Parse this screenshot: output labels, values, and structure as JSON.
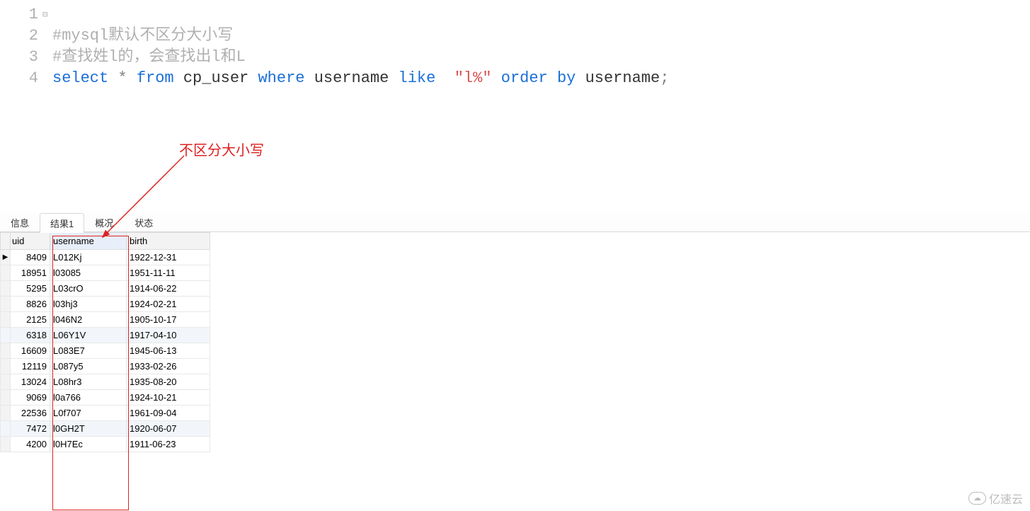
{
  "editor": {
    "lines": {
      "l1": {
        "num": "1",
        "fold": "⊟",
        "comment": "#mysql默认不区分大小写"
      },
      "l2": {
        "num": "2",
        "comment": "#查找姓l的，会查找出l和L"
      },
      "l3": {
        "num": "3",
        "sql": {
          "select": "select",
          "star": "*",
          "from": "from",
          "tbl": "cp_user",
          "where": "where",
          "col": "username",
          "like": "like",
          "str": "\"l%\"",
          "order": "order by",
          "col2": "username",
          "semi": ";"
        }
      },
      "l4": {
        "num": "4"
      }
    }
  },
  "tabs": [
    {
      "label": "信息",
      "active": false
    },
    {
      "label": "结果1",
      "active": true
    },
    {
      "label": "概况",
      "active": false
    },
    {
      "label": "状态",
      "active": false
    }
  ],
  "columns": {
    "uid": "uid",
    "username": "username",
    "birth": "birth"
  },
  "rows": [
    {
      "uid": "8409",
      "username": "L012Kj",
      "birth": "1922-12-31",
      "sel": true
    },
    {
      "uid": "18951",
      "username": "l03085",
      "birth": "1951-11-11"
    },
    {
      "uid": "5295",
      "username": "L03crO",
      "birth": "1914-06-22"
    },
    {
      "uid": "8826",
      "username": "l03hj3",
      "birth": "1924-02-21"
    },
    {
      "uid": "2125",
      "username": "l046N2",
      "birth": "1905-10-17"
    },
    {
      "uid": "6318",
      "username": "L06Y1V",
      "birth": "1917-04-10",
      "hl": true
    },
    {
      "uid": "16609",
      "username": "L083E7",
      "birth": "1945-06-13"
    },
    {
      "uid": "12119",
      "username": "L087y5",
      "birth": "1933-02-26"
    },
    {
      "uid": "13024",
      "username": "L08hr3",
      "birth": "1935-08-20"
    },
    {
      "uid": "9069",
      "username": "l0a766",
      "birth": "1924-10-21"
    },
    {
      "uid": "22536",
      "username": "L0f707",
      "birth": "1961-09-04"
    },
    {
      "uid": "7472",
      "username": "l0GH2T",
      "birth": "1920-06-07",
      "hl": true
    },
    {
      "uid": "4200",
      "username": "l0H7Ec",
      "birth": "1911-06-23"
    }
  ],
  "annotation": {
    "label": "不区分大小写"
  },
  "watermark": {
    "text": "亿速云"
  }
}
